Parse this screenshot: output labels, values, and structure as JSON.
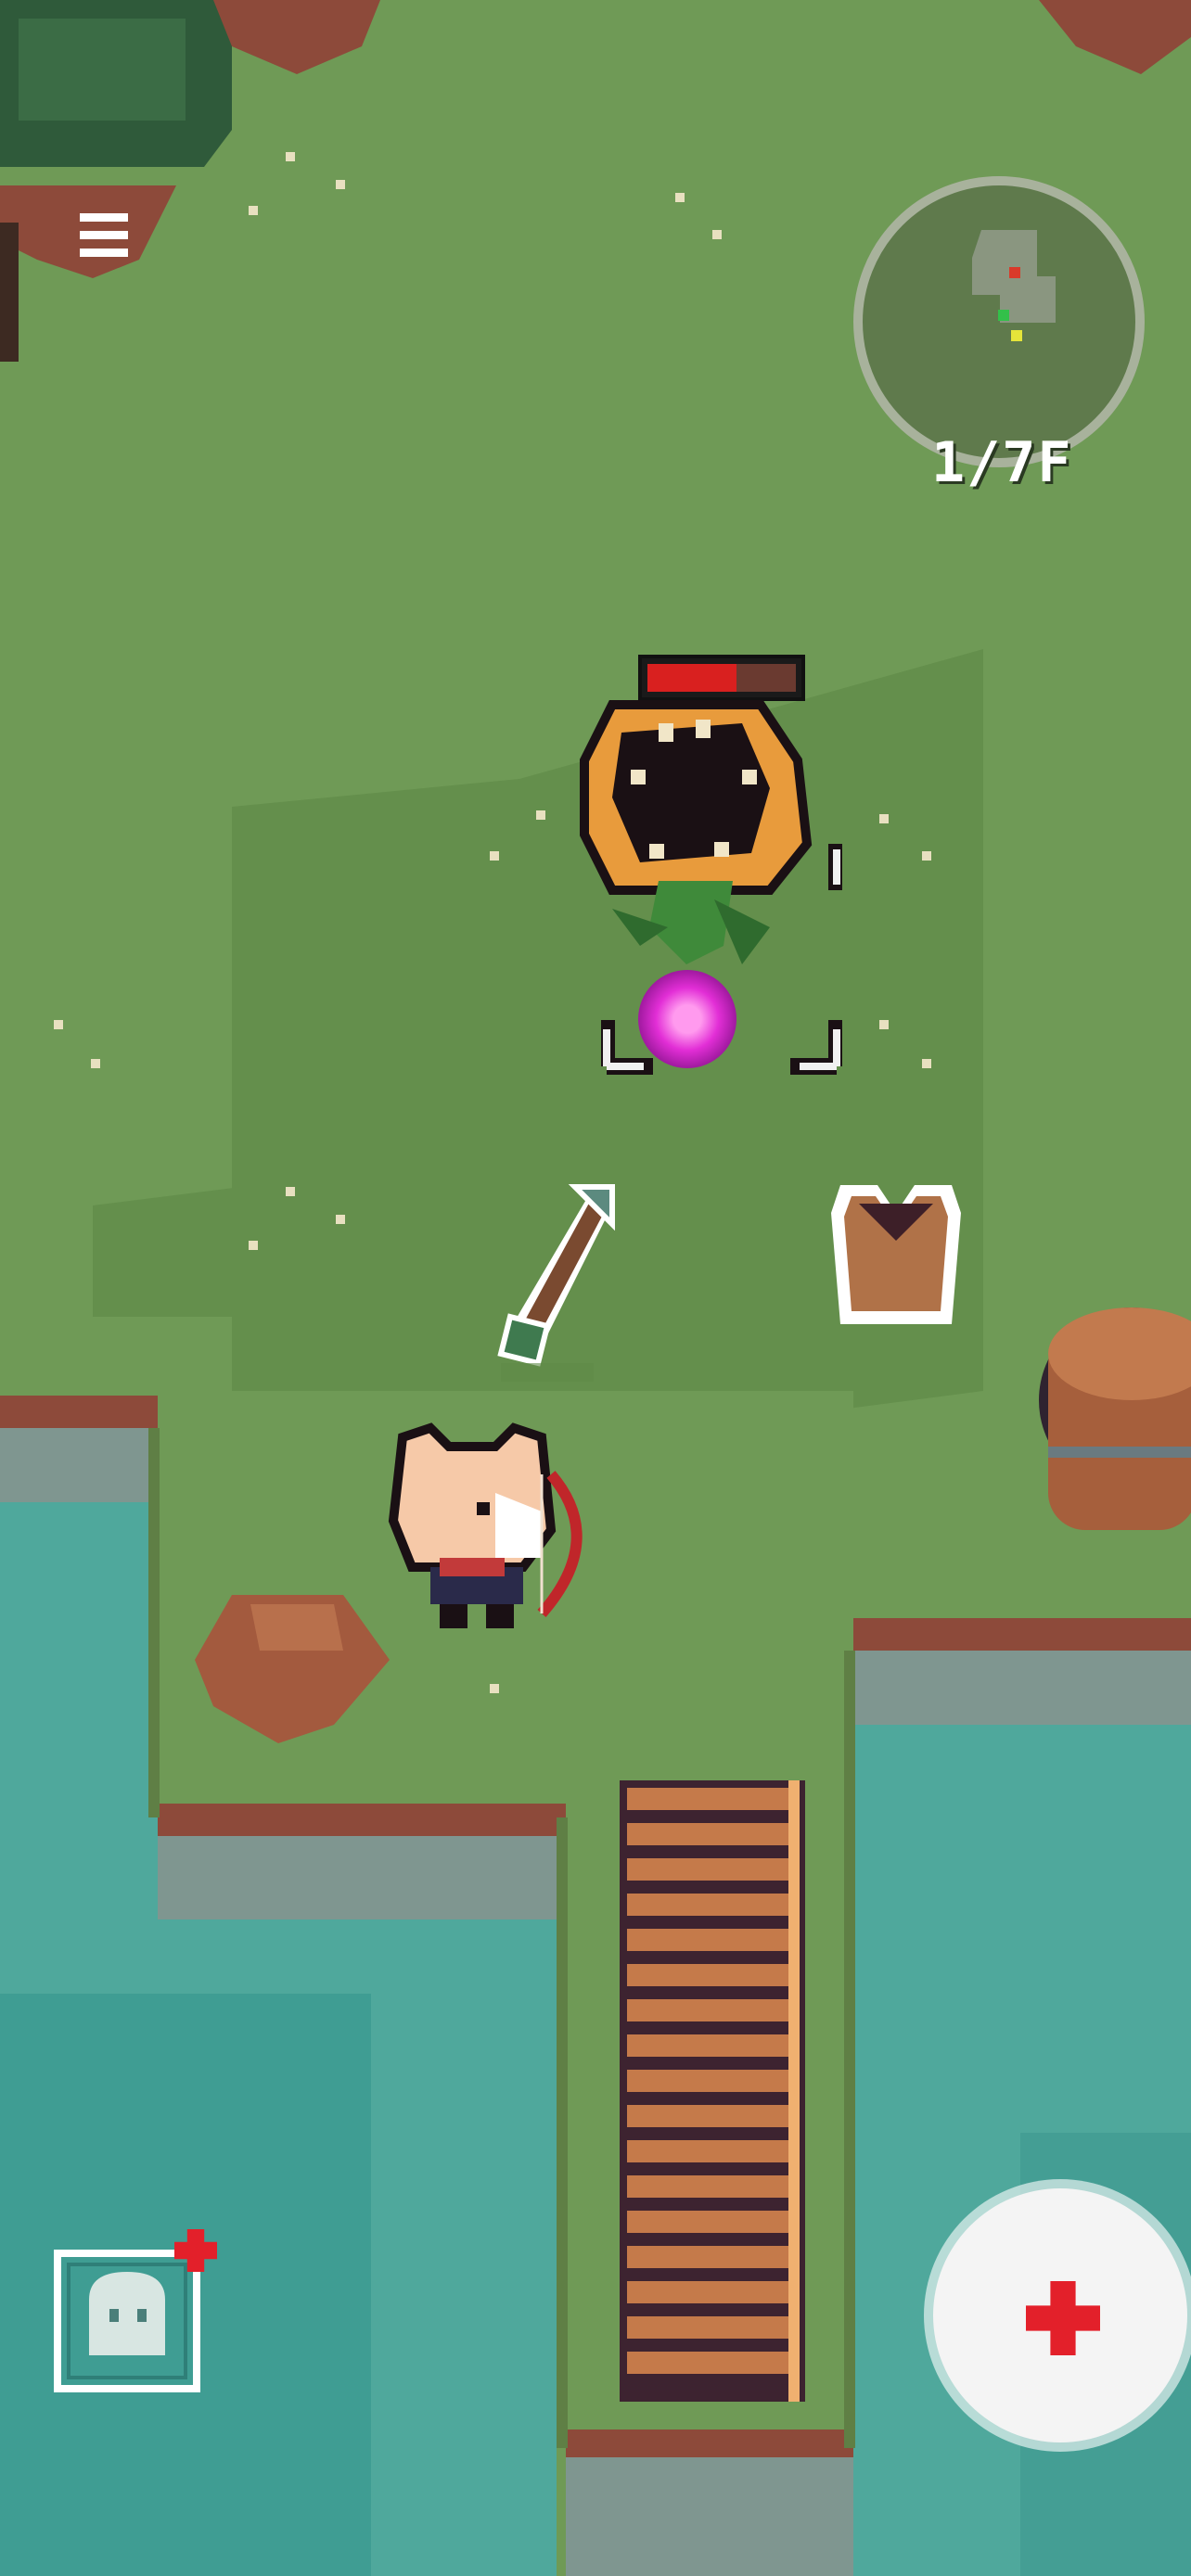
{
  "hud": {
    "menu_icon": "hamburger-menu-icon",
    "minimap": {
      "floor_label": "1/7F",
      "markers": {
        "enemy": "#d93a2a",
        "player": "#e5e53a",
        "exit": "#33c04a"
      }
    },
    "pet_button": {
      "icon": "ghost-face-icon",
      "has_notification": true,
      "notification_color": "#e3202a"
    },
    "heal_button": {
      "icon": "red-cross-icon",
      "color": "#e3202a"
    }
  },
  "enemy": {
    "name_icon": "sunflower-chomper-icon",
    "health_fraction": 0.6,
    "health_color": "#d9201f"
  },
  "player": {
    "icon": "cat-archer-icon",
    "weapon": "bow"
  },
  "items": [
    {
      "kind": "arrow",
      "icon": "arrow-pickup-icon"
    },
    {
      "kind": "armor",
      "icon": "leather-vest-icon"
    }
  ],
  "colors": {
    "grass": "#6f9a56",
    "grass_dark": "#5f8a48",
    "water": "#4aa59a",
    "bridge": "#b06a3e",
    "cliff": "#8d4a3a"
  }
}
